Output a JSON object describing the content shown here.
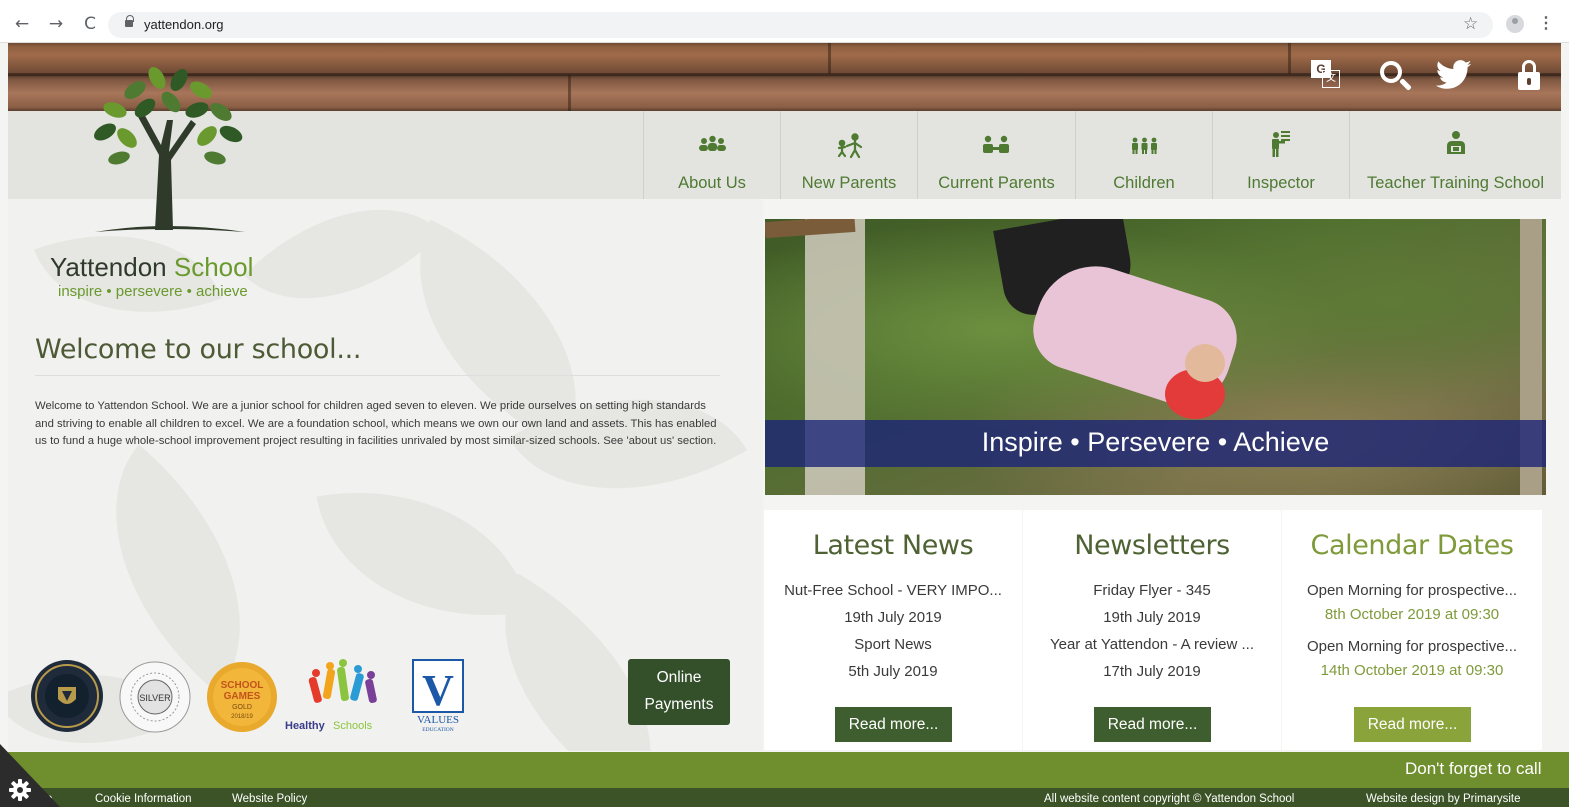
{
  "browser": {
    "url": "yattendon.org",
    "back_glyph": "←",
    "forward_glyph": "→",
    "reload_glyph": "C",
    "star_glyph": "☆",
    "menu_glyph": "⋮"
  },
  "header": {
    "icons": [
      "google-translate-icon",
      "search-icon",
      "twitter-icon",
      "lock-icon"
    ],
    "translate_glyph_a": "G",
    "translate_glyph_b": "文"
  },
  "nav": {
    "items": [
      {
        "label": "About Us",
        "icon": "group-icon"
      },
      {
        "label": "New Parents",
        "icon": "adult-child-icon"
      },
      {
        "label": "Current Parents",
        "icon": "parents-icon"
      },
      {
        "label": "Children",
        "icon": "children-icon"
      },
      {
        "label": "Inspector",
        "icon": "presenter-icon"
      },
      {
        "label": "Teacher Training School",
        "icon": "teacher-icon"
      }
    ]
  },
  "school": {
    "name_part1": "Yattendon",
    "name_part2": "School",
    "tagline": "inspire • persevere • achieve"
  },
  "welcome": {
    "heading": "Welcome to our school...",
    "body": "Welcome to Yattendon School. We are a junior school for children aged seven to eleven. We pride ourselves on setting high standards and striving to enable all children to excel. We are a foundation school, which means we own our own land and assets. This has enabled us to fund a huge whole-school improvement project resulting in facilities unrivaled by most similar-sized schools. See 'about us' section."
  },
  "badges": {
    "silver_text": "SILVER",
    "silver_ring": "Surrey anti-bullying charter mark",
    "games_line1": "SCHOOL",
    "games_line2": "GAMES",
    "games_line3": "GOLD",
    "games_line4": "2018/19",
    "healthy_a": "Healthy",
    "healthy_b": "Schools",
    "values_a": "VALUES",
    "values_b": "EDUCATION",
    "values_letter": "V"
  },
  "payments": {
    "line1": "Online",
    "line2": "Payments"
  },
  "hero": {
    "caption": "Inspire • Persevere • Achieve"
  },
  "cards": [
    {
      "title": "Latest News",
      "rows": [
        "Nut-Free School - VERY IMPO...",
        "19th July 2019",
        "Sport News",
        "5th July 2019"
      ],
      "button": "Read more..."
    },
    {
      "title": "Newsletters",
      "rows": [
        "Friday Flyer - 345",
        "19th July 2019",
        "Year at Yattendon - A review ...",
        "17th July 2019"
      ],
      "button": "Read more..."
    },
    {
      "title": "Calendar Dates",
      "rows": [
        "Open Morning for prospective...",
        "8th October 2019 at 09:30",
        "Open Morning for prospective...",
        "14th October 2019 at 09:30"
      ],
      "button": "Read more..."
    }
  ],
  "footer": {
    "reminder": "Don't forget to call",
    "links": [
      "Cookie Information",
      "Website Policy"
    ],
    "partial_link": "ro",
    "copyright": "All website content copyright © Yattendon School",
    "design": "Website design by Primarysite"
  },
  "colors": {
    "brand_green": "#4e7a32",
    "dark_green": "#34502b",
    "light_green": "#8aa33a",
    "hero_caption_bg": "#1a2278"
  }
}
